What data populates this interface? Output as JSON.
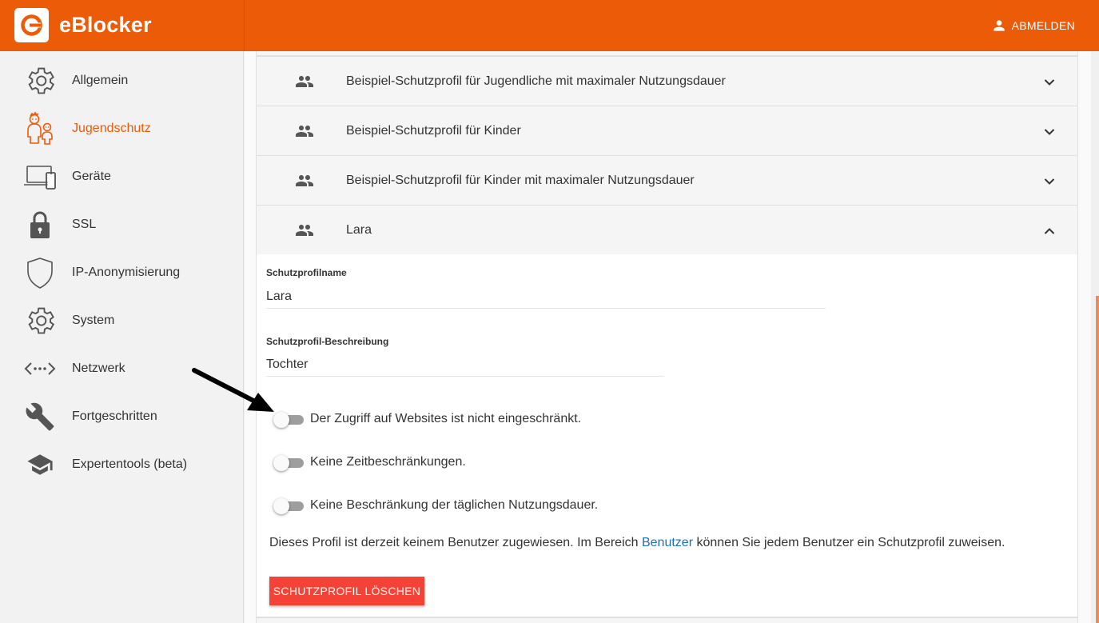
{
  "app": {
    "brand": "eBlocker",
    "logout_label": "ABMELDEN"
  },
  "colors": {
    "accent": "#ec5b08",
    "danger": "#f44336",
    "link": "#1e6fb8"
  },
  "sidebar": {
    "items": [
      {
        "label": "Allgemein",
        "icon": "gear-icon",
        "active": false
      },
      {
        "label": "Jugendschutz",
        "icon": "family-icon",
        "active": true
      },
      {
        "label": "Geräte",
        "icon": "devices-icon",
        "active": false
      },
      {
        "label": "SSL",
        "icon": "lock-icon",
        "active": false
      },
      {
        "label": "IP-Anonymisierung",
        "icon": "shield-icon",
        "active": false
      },
      {
        "label": "System",
        "icon": "gear-icon",
        "active": false
      },
      {
        "label": "Netzwerk",
        "icon": "network-icon",
        "active": false
      },
      {
        "label": "Fortgeschritten",
        "icon": "wrench-icon",
        "active": false
      },
      {
        "label": "Expertentools (beta)",
        "icon": "graduation-cap-icon",
        "active": false
      }
    ]
  },
  "profiles": [
    {
      "title": "Beispiel-Schutzprofil für Jugendliche mit maximaler Nutzungsdauer",
      "expanded": false
    },
    {
      "title": "Beispiel-Schutzprofil für Kinder",
      "expanded": false
    },
    {
      "title": "Beispiel-Schutzprofil für Kinder mit maximaler Nutzungsdauer",
      "expanded": false
    },
    {
      "title": "Lara",
      "expanded": true
    }
  ],
  "expanded_profile": {
    "name_label": "Schutzprofilname",
    "name_value": "Lara",
    "description_label": "Schutzprofil-Beschreibung",
    "description_value": "Tochter",
    "toggles": [
      {
        "label": "Der Zugriff auf Websites ist nicht eingeschränkt.",
        "on": false
      },
      {
        "label": "Keine Zeitbeschränkungen.",
        "on": false
      },
      {
        "label": "Keine Beschränkung der täglichen Nutzungsdauer.",
        "on": false
      }
    ],
    "info_before": "Dieses Profil ist derzeit keinem Benutzer zugewiesen. Im Bereich ",
    "info_link": "Benutzer",
    "info_after": " können Sie jedem Benutzer ein Schutzprofil zuweisen.",
    "delete_label": "SCHUTZPROFIL LÖSCHEN"
  }
}
